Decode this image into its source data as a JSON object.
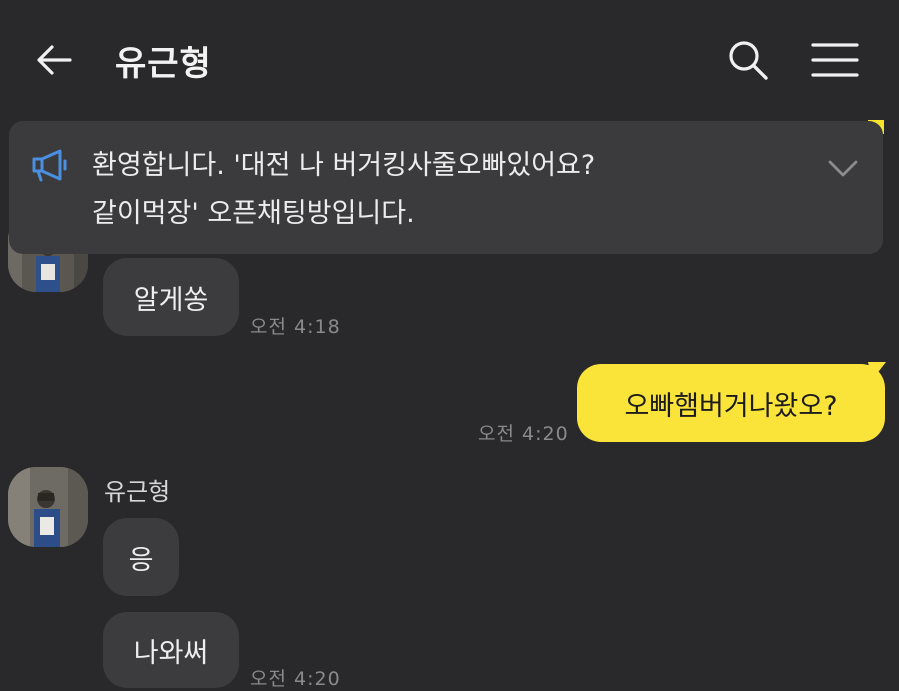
{
  "header": {
    "back_icon": "arrow-left-icon",
    "title": "유근형",
    "search_icon": "search-icon",
    "menu_icon": "hamburger-menu-icon"
  },
  "notice": {
    "icon": "megaphone-icon",
    "text": "환영합니다. '대전 나 버거킹사줄오빠있어요?\n같이먹장' 오픈채팅방입니다.",
    "expand_icon": "chevron-down-icon"
  },
  "messages": [
    {
      "direction": "in",
      "text": "알게쏭",
      "time": "오전 4:18"
    },
    {
      "direction": "out",
      "text": "오빠햄버거나왔오?",
      "time": "오전 4:20"
    },
    {
      "direction": "in",
      "sender": "유근형",
      "text": "응"
    },
    {
      "direction": "in",
      "text": "나와써",
      "time": "오전 4:20"
    }
  ],
  "colors": {
    "background": "#29292b",
    "incoming_bubble": "#3c3c3e",
    "outgoing_bubble": "#fbe43a",
    "notice_background": "#3b3b3d"
  }
}
